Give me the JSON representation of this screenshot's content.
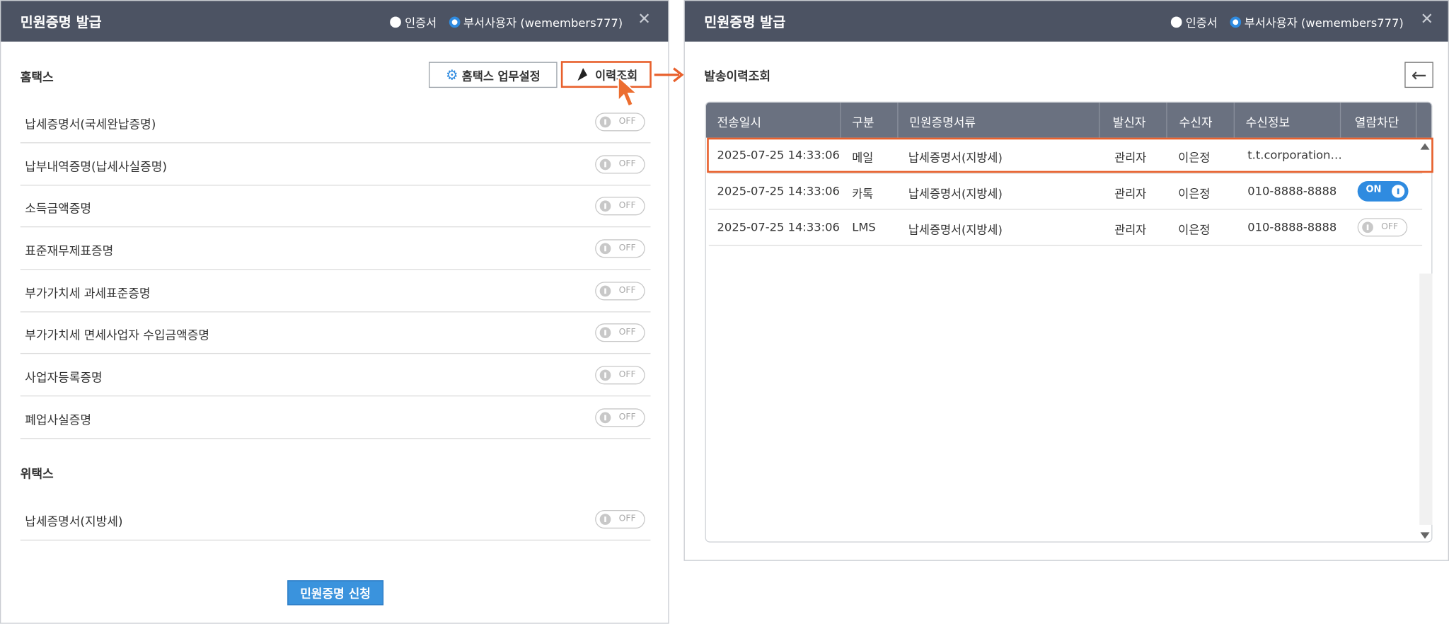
{
  "left_panel": {
    "title": "민원증명 발급",
    "radio_cert": "인증서",
    "radio_dept": "부서사용자 (wemembers777)",
    "section_hometax": "홈택스",
    "btn_settings": "홈택스 업무설정",
    "btn_history": "이력조회",
    "hometax_items": [
      {
        "label": "납세증명서(국세완납증명)",
        "toggle": "OFF"
      },
      {
        "label": "납부내역증명(납세사실증명)",
        "toggle": "OFF"
      },
      {
        "label": "소득금액증명",
        "toggle": "OFF"
      },
      {
        "label": "표준재무제표증명",
        "toggle": "OFF"
      },
      {
        "label": "부가가치세 과세표준증명",
        "toggle": "OFF"
      },
      {
        "label": "부가가치세 면세사업자 수입금액증명",
        "toggle": "OFF"
      },
      {
        "label": "사업자등록증명",
        "toggle": "OFF"
      },
      {
        "label": "폐업사실증명",
        "toggle": "OFF"
      }
    ],
    "section_wetax": "위택스",
    "wetax_items": [
      {
        "label": "납세증명서(지방세)",
        "toggle": "OFF"
      }
    ],
    "btn_apply": "민원증명 신청"
  },
  "right_panel": {
    "title": "민원증명 발급",
    "radio_cert": "인증서",
    "radio_dept": "부서사용자 (wemembers777)",
    "section_title": "발송이력조회",
    "columns": [
      "전송일시",
      "구분",
      "민원증명서류",
      "발신자",
      "수신자",
      "수신정보",
      "열람차단"
    ],
    "rows": [
      {
        "datetime": "2025-07-25 14:33:06",
        "type": "메일",
        "doc": "납세증명서(지방세)",
        "sender": "관리자",
        "receiver": "이은정",
        "info": "t.t.corporation…",
        "block": ""
      },
      {
        "datetime": "2025-07-25 14:33:06",
        "type": "카톡",
        "doc": "납세증명서(지방세)",
        "sender": "관리자",
        "receiver": "이은정",
        "info": "010-8888-8888",
        "block": "ON"
      },
      {
        "datetime": "2025-07-25 14:33:06",
        "type": "LMS",
        "doc": "납세증명서(지방세)",
        "sender": "관리자",
        "receiver": "이은정",
        "info": "010-8888-8888",
        "block": "OFF"
      }
    ]
  },
  "colors": {
    "titlebar": "#4c5363",
    "accent": "#2f8be0",
    "highlight": "#e8602c",
    "table_header": "#6a7180"
  }
}
